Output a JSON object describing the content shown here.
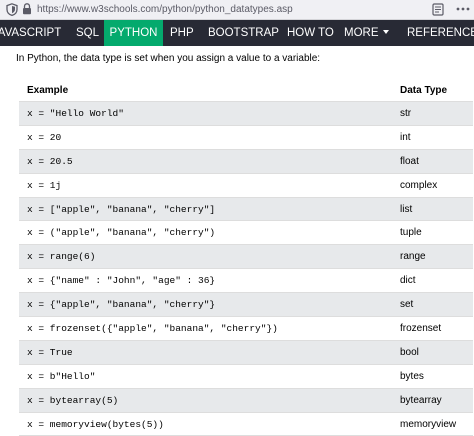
{
  "browser": {
    "url": "https://www.w3schools.com/python/python_datatypes.asp",
    "icons": [
      "shield-icon",
      "lock-icon",
      "reader-view-icon",
      "more-menu-icon"
    ]
  },
  "nav": {
    "items": [
      {
        "label": "JAVASCRIPT"
      },
      {
        "label": "SQL"
      },
      {
        "label": "PYTHON"
      },
      {
        "label": "PHP"
      },
      {
        "label": "BOOTSTRAP"
      },
      {
        "label": "HOW TO"
      },
      {
        "label": "MORE"
      },
      {
        "label": "REFERENCES"
      }
    ],
    "active": "PYTHON",
    "colors": {
      "background": "#282a35",
      "active": "#04aa6d"
    }
  },
  "intro": "In Python, the data type is set when you assign a value to a variable:",
  "table": {
    "headers": [
      "Example",
      "Data Type"
    ],
    "rows": [
      {
        "example": "x = \"Hello World\"",
        "type": "str"
      },
      {
        "example": "x = 20",
        "type": "int"
      },
      {
        "example": "x = 20.5",
        "type": "float"
      },
      {
        "example": "x = 1j",
        "type": "complex"
      },
      {
        "example": "x = [\"apple\", \"banana\", \"cherry\"]",
        "type": "list"
      },
      {
        "example": "x = (\"apple\", \"banana\", \"cherry\")",
        "type": "tuple"
      },
      {
        "example": "x = range(6)",
        "type": "range"
      },
      {
        "example": "x = {\"name\" : \"John\", \"age\" : 36}",
        "type": "dict"
      },
      {
        "example": "x = {\"apple\", \"banana\", \"cherry\"}",
        "type": "set"
      },
      {
        "example": "x = frozenset({\"apple\", \"banana\", \"cherry\"})",
        "type": "frozenset"
      },
      {
        "example": "x = True",
        "type": "bool"
      },
      {
        "example": "x = b\"Hello\"",
        "type": "bytes"
      },
      {
        "example": "x = bytearray(5)",
        "type": "bytearray"
      },
      {
        "example": "x = memoryview(bytes(5))",
        "type": "memoryview"
      }
    ],
    "colors": {
      "stripe": "#e7e9eb",
      "border": "#dddddd"
    }
  }
}
